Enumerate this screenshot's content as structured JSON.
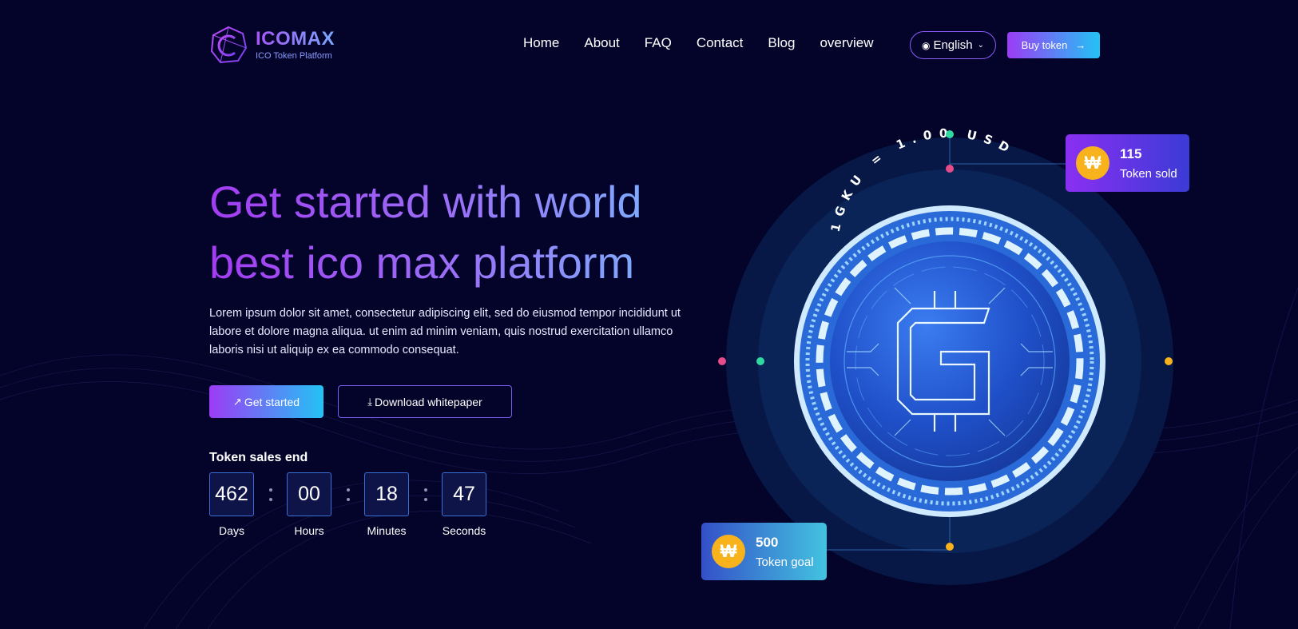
{
  "brand": {
    "name": "ICOMAX",
    "tagline": "ICO Token Platform"
  },
  "nav": {
    "items": [
      "Home",
      "About",
      "FAQ",
      "Contact",
      "Blog",
      "overview"
    ]
  },
  "language": {
    "selected": "English"
  },
  "buy_button": {
    "label": "Buy token"
  },
  "hero": {
    "title_line1": "Get started with world",
    "title_line2": "best ico max platform",
    "description": "Lorem ipsum dolor sit amet, consectetur adipiscing elit, sed do eiusmod tempor incididunt ut labore et dolore magna aliqua. ut enim ad minim veniam, quis nostrud exercitation ullamco laboris nisi ut aliquip ex ea commodo consequat.",
    "primary_button": "Get started",
    "secondary_button": "Download whitepaper"
  },
  "countdown": {
    "title": "Token sales end",
    "units": [
      {
        "value": "462",
        "label": "Days"
      },
      {
        "value": "00",
        "label": "Hours"
      },
      {
        "value": "18",
        "label": "Minutes"
      },
      {
        "value": "47",
        "label": "Seconds"
      }
    ]
  },
  "coin": {
    "rate_text": "1GKU = 1.00 USD",
    "symbol": "G"
  },
  "stats": {
    "sold": {
      "value": "115",
      "label": "Token sold"
    },
    "goal": {
      "value": "500",
      "label": "Token goal"
    }
  },
  "colors": {
    "background": "#04042a",
    "accent_purple": "#9b3cf5",
    "accent_cyan": "#23c3f5",
    "coin_gold": "#f8b31c"
  },
  "icons": {
    "logo": "hexagon-c-logo-icon",
    "globe": "globe-icon",
    "chevron": "chevron-down-icon",
    "arrow": "arrow-right-icon",
    "start": "arrow-up-right-icon",
    "download": "download-icon",
    "token": "won-coin-icon"
  }
}
